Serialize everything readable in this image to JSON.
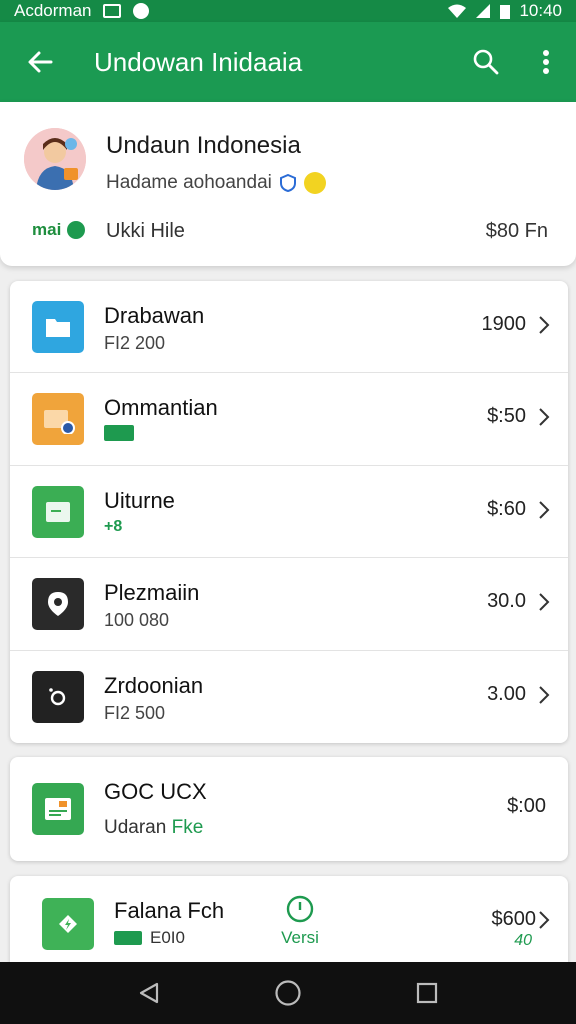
{
  "status_bar": {
    "app_name": "Acdorman",
    "time": "10:40"
  },
  "app_bar": {
    "title": "Undowan Inidaaia"
  },
  "profile": {
    "name": "Undaun Indonesia",
    "subtitle": "Hadame aohoandai",
    "tag": "mai",
    "label": "Ukki Hile",
    "value": "$80 Fn"
  },
  "list_items": [
    {
      "name": "Drabawan",
      "meta": "FI2 200",
      "value": "1900",
      "icon_color": "#2fa6e0",
      "icon": "folder-icon"
    },
    {
      "name": "Ommantian",
      "meta": "",
      "value": "$:50",
      "icon_color": "#f0a43b",
      "icon": "folder-camera-icon"
    },
    {
      "name": "Uiturne",
      "meta": "+8",
      "value": "$:60",
      "icon_color": "#3bae54",
      "icon": "file-icon"
    },
    {
      "name": "Plezmaiin",
      "meta": "100 080",
      "value": "30.0",
      "icon_color": "#2a2a2a",
      "icon": "location-pin-icon"
    },
    {
      "name": "Zrdoonian",
      "meta": "FI2 500",
      "value": "3.00",
      "icon_color": "#222222",
      "icon": "camera-icon"
    }
  ],
  "card2": {
    "name": "GOC UCX",
    "sub_prefix": "Udaran",
    "sub_green": "Fke",
    "value": "$:00"
  },
  "card3": {
    "name": "Falana Fch",
    "meta": "E0I0",
    "version_label": "Versi",
    "value": "$600",
    "subvalue": "40"
  },
  "colors": {
    "primary": "#1b9a52",
    "status": "#158a46",
    "accent_green": "#1e9a4f"
  }
}
